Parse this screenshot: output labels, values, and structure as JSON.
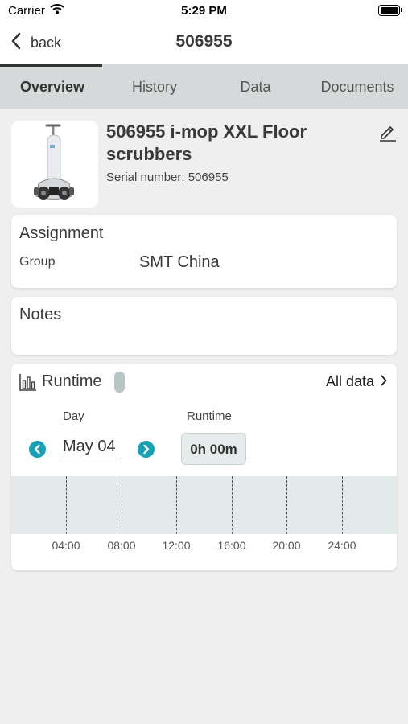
{
  "status": {
    "carrier": "Carrier",
    "time": "5:29 PM"
  },
  "nav": {
    "back_label": "back",
    "title": "506955"
  },
  "tabs": [
    {
      "label": "Overview",
      "active": true
    },
    {
      "label": "History",
      "active": false
    },
    {
      "label": "Data",
      "active": false
    },
    {
      "label": "Documents",
      "active": false
    }
  ],
  "machine": {
    "title": "506955 i-mop XXL Floor scrubbers",
    "serial": "Serial number: 506955"
  },
  "assignment": {
    "title": "Assignment",
    "group_label": "Group",
    "group_value": "SMT China"
  },
  "notes": {
    "title": "Notes"
  },
  "runtime": {
    "title": "Runtime",
    "all_data_label": "All data",
    "day_label": "Day",
    "runtime_label": "Runtime",
    "day_value": "May 04",
    "runtime_value": "0h 00m",
    "ticks": [
      "04:00",
      "08:00",
      "12:00",
      "16:00",
      "20:00",
      "24:00"
    ]
  },
  "colors": {
    "accent": "#15a0b6",
    "tab_bar": "#d6d9d9",
    "timeline_bg": "#e2ebea"
  }
}
